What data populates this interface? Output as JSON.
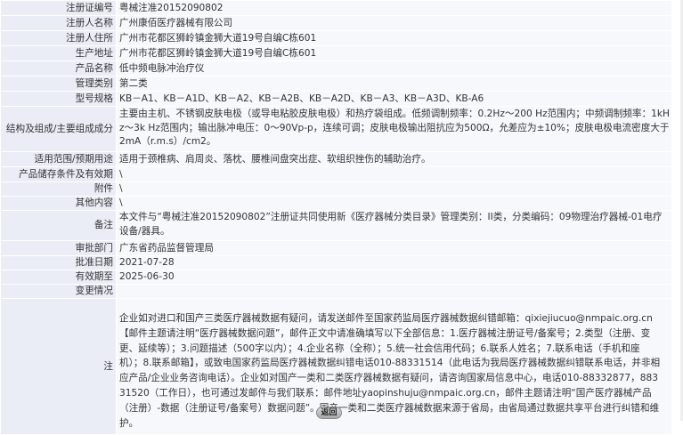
{
  "record": {
    "rows": [
      {
        "label": "注册证编号",
        "value": "粤械注准20152090802"
      },
      {
        "label": "注册人名称",
        "value": "广州康佰医疗器械有限公司"
      },
      {
        "label": "注册人住所",
        "value": "广州市花都区狮岭镇金狮大道19号自编C栋601"
      },
      {
        "label": "生产地址",
        "value": "广州市花都区狮岭镇金狮大道19号自编C栋601"
      },
      {
        "label": "产品名称",
        "value": "低中频电脉冲治疗仪"
      },
      {
        "label": "管理类别",
        "value": "第二类"
      },
      {
        "label": "型号规格",
        "value": "KB－A1、KB－A1D、KB－A2、KB－A2B、KB－A2D、KB－A3、KB－A3D、KB-A6"
      },
      {
        "label": "结构及组成/主要组成成分",
        "value": "主要由主机、不锈钢皮肤电极（或导电粘胶皮肤电极）和热疗袋组成。低频调制频率：0.2Hz～200 Hz范围内；中频调制频率：1kHz～3k Hz范围内；输出脉冲电压：0～90Vp-p，连续可调；皮肤电极输出阻抗应为500Ω，允差应为±10%；皮肤电极电流密度大于2mA（r.m.s）/cm2。"
      },
      {
        "label": "适用范围/预期用途",
        "value": "适用于颈椎病、肩周炎、落枕、腰椎间盘突出症、软组织挫伤的辅助治疗。"
      },
      {
        "label": "产品储存条件及有效期",
        "value": "\\"
      },
      {
        "label": "附件",
        "value": "\\"
      },
      {
        "label": "其他内容",
        "value": "\\"
      },
      {
        "label": "备注",
        "value": "本文件与“粤械注准20152090802”注册证共同使用新《医疗器械分类目录》管理类别：II类，分类编码：09物理治疗器械-01电疗设备/器具。"
      },
      {
        "label": "审批部门",
        "value": "广东省药品监督管理局"
      },
      {
        "label": "批准日期",
        "value": "2021-07-28"
      },
      {
        "label": "有效期至",
        "value": "2025-06-30"
      },
      {
        "label": "变更情况",
        "value": ""
      },
      {
        "label": "注",
        "value": "企业如对进口和国产三类医疗器械数据有疑问，请发送邮件至国家药监局医疗器械数据纠错邮箱：qixiejiucuo@nmpaic.org.cn【邮件主题请注明“医疗器械数据问题”，邮件正文中请准确填写以下全部信息：1.医疗器械注册证号/备案号；2.类型（注册、变更、延续等）；3.问题描述（500字以内）；4.企业名称（全称）；5.统一社会信用代码；6.联系人姓名；7.联系电话（手机和座机）；8.联系邮箱】，或致电国家药监局医疗器械数据纠错电话010-88331514（此电话为我局医疗器械数据纠错联系电话，并非相应产品/企业业务咨询电话）。企业如对国产一类和二类医疗器械数据有疑问，请咨询国家局信息中心，电话010-88332877，88331520（工作日），也可通过发邮件与我们联系：邮件地址yaopinshuju@nmpaic.org.cn，邮件主题请注明“国产医疗器械产品（注册）-数据（注册证号/备案号）数据问题”。国产一类和二类医疗器械数据来源于省局，由省局通过数据共享平台进行纠错和维护。"
      }
    ]
  },
  "footer": {
    "return_label": "返回"
  },
  "colors": {
    "label_bg": "#eaedf5",
    "value_bg": "#f7f8fb",
    "text": "#333333"
  }
}
